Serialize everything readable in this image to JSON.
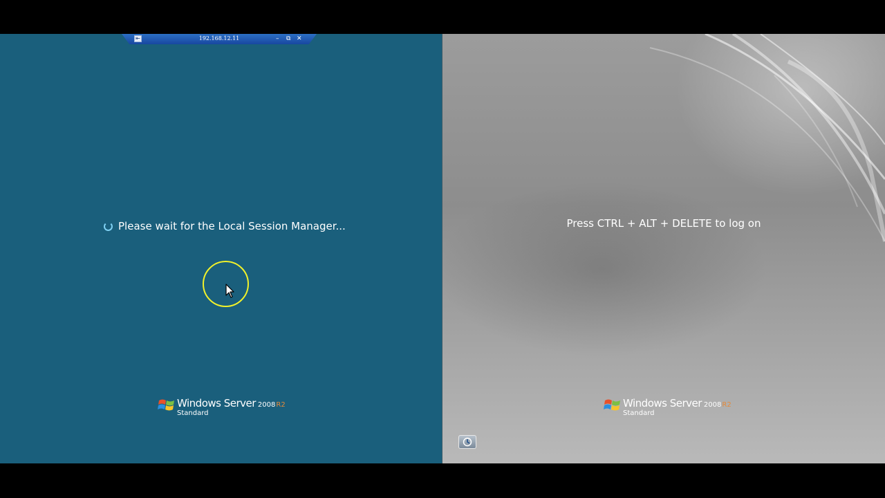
{
  "remote_bar": {
    "host": "192.168.12.11",
    "pin_glyph": "⇤",
    "minimize_glyph": "–",
    "restore_glyph": "⧉",
    "close_glyph": "✕"
  },
  "left_session": {
    "status_text": "Please wait for the Local Session Manager...",
    "background_color": "#1a5f7c"
  },
  "right_session": {
    "prompt_text": "Press CTRL + ALT + DELETE to log on"
  },
  "branding": {
    "name": "Windows Server",
    "version": "2008",
    "release": "R2",
    "edition": "Standard"
  },
  "colors": {
    "cursor_highlight": "#f2f22a",
    "release_accent": "#e58a3a"
  }
}
